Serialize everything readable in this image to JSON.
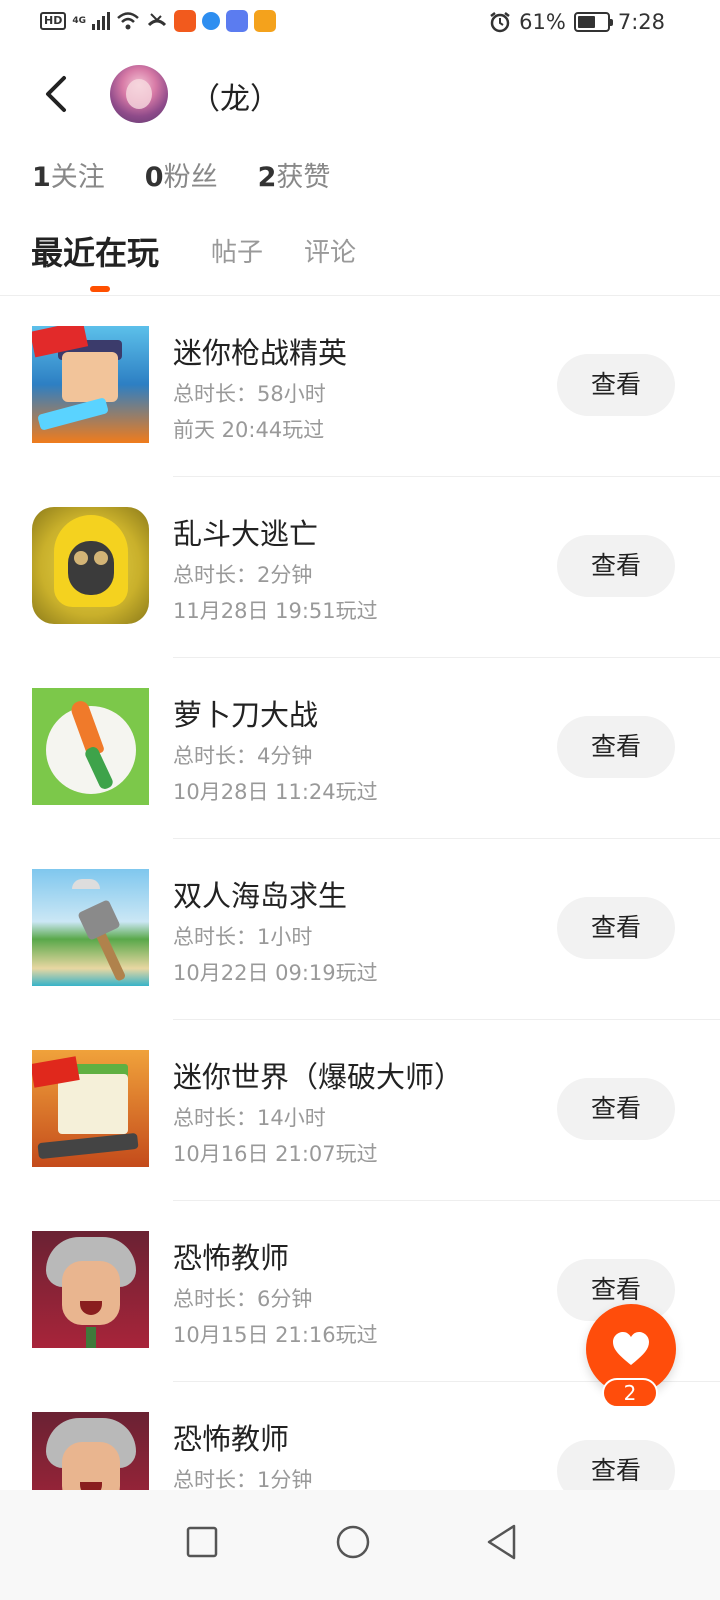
{
  "status_bar": {
    "hd": "HD",
    "network": "4G",
    "battery_percent": "61%",
    "battery_level": 0.61,
    "time": "7:28",
    "icons": [
      "hd-icon",
      "signal-icon",
      "wifi-icon",
      "missed-call-icon",
      "app-icon",
      "browser-icon",
      "edu-app-icon",
      "news-app-icon",
      "alarm-icon",
      "battery-icon"
    ]
  },
  "header": {
    "user_name": "（龙）"
  },
  "stats": {
    "following_count": "1",
    "following_label": "关注",
    "fans_count": "0",
    "fans_label": "粉丝",
    "likes_count": "2",
    "likes_label": "获赞"
  },
  "tabs": [
    {
      "label": "最近在玩",
      "active": true
    },
    {
      "label": "帖子",
      "active": false
    },
    {
      "label": "评论",
      "active": false
    }
  ],
  "games": [
    {
      "title": "迷你枪战精英",
      "duration": "总时长：58小时",
      "last_played": "前天 20:44玩过",
      "button": "查看"
    },
    {
      "title": "乱斗大逃亡",
      "duration": "总时长：2分钟",
      "last_played": "11月28日 19:51玩过",
      "button": "查看"
    },
    {
      "title": "萝卜刀大战",
      "duration": "总时长：4分钟",
      "last_played": "10月28日 11:24玩过",
      "button": "查看"
    },
    {
      "title": "双人海岛求生",
      "duration": "总时长：1小时",
      "last_played": "10月22日 09:19玩过",
      "button": "查看"
    },
    {
      "title": "迷你世界（爆破大师）",
      "duration": "总时长：14小时",
      "last_played": "10月16日 21:07玩过",
      "button": "查看"
    },
    {
      "title": "恐怖教师",
      "duration": "总时长：6分钟",
      "last_played": "10月15日 21:16玩过",
      "button": "查看"
    },
    {
      "title": "恐怖教师",
      "duration": "总时长：1分钟",
      "last_played": "",
      "button": "查看"
    }
  ],
  "like_fab": {
    "count": "2",
    "icon": "heart-icon"
  },
  "colors": {
    "accent": "#ff4d0b",
    "text_primary": "#222222",
    "text_secondary": "#999999",
    "button_bg": "#f2f2f2"
  }
}
